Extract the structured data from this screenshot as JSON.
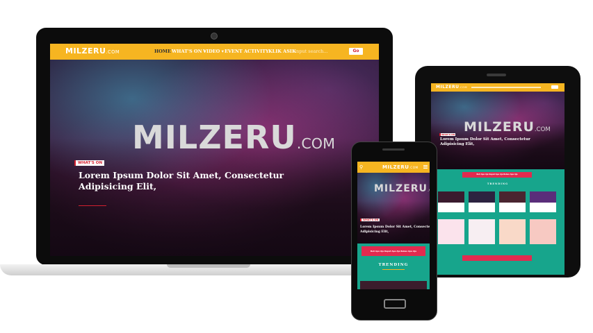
{
  "brand": {
    "logo": "MILZERU",
    "logo_suffix": ".COM"
  },
  "nav": {
    "items": [
      {
        "label": "HOME"
      },
      {
        "label": "WHAT'S ON ▾"
      },
      {
        "label": "VIDEO ▾"
      },
      {
        "label": "EVENT"
      },
      {
        "label": "ACTIVITY"
      },
      {
        "label": "KLIK ASIK"
      }
    ],
    "search_placeholder": "input search...",
    "go_label": "Go"
  },
  "hero": {
    "badge": "WHAT'S ON",
    "headline_line1": "Lorem Ipsum Dolor Sit Amet, Consectetur",
    "headline_line2": "Adipisicing Elit,"
  },
  "tablet": {
    "promo": "Beli Apa Aja Dapat Apa Aja Bebas Apa Aja",
    "trending": "TRENDING"
  },
  "phone": {
    "promo": "Beli Apa Aja Dapat Apa Aja Bebas Apa Aja",
    "trending": "TRENDING"
  },
  "colors": {
    "accent_yellow": "#f6b521",
    "brand_red": "#d3202f",
    "teal": "#17a58c",
    "promo_pink": "#e22a4f"
  }
}
